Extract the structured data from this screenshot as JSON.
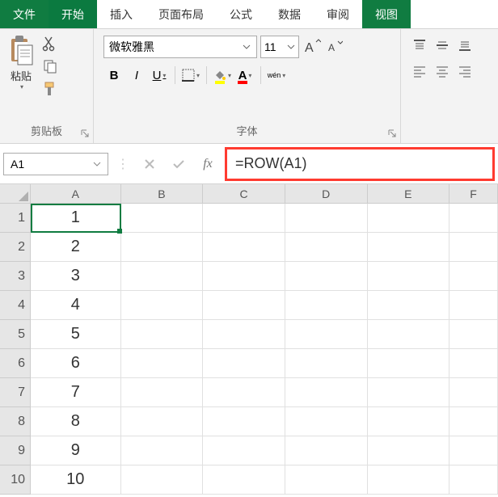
{
  "menu": {
    "file": "文件",
    "home": "开始",
    "insert": "插入",
    "layout": "页面布局",
    "formula": "公式",
    "data": "数据",
    "review": "审阅",
    "view": "视图"
  },
  "ribbon": {
    "clipboard": {
      "label": "剪贴板",
      "paste": "粘贴"
    },
    "font": {
      "label": "字体",
      "name": "微软雅黑",
      "size": "11",
      "wen": "wén"
    }
  },
  "formula_bar": {
    "cell_ref": "A1",
    "formula": "=ROW(A1)"
  },
  "grid": {
    "columns": [
      "A",
      "B",
      "C",
      "D",
      "E",
      "F"
    ],
    "rows": [
      "1",
      "2",
      "3",
      "4",
      "5",
      "6",
      "7",
      "8",
      "9",
      "10"
    ],
    "valuesA": [
      "1",
      "2",
      "3",
      "4",
      "5",
      "6",
      "7",
      "8",
      "9",
      "10"
    ]
  },
  "chart_data": {
    "type": "table",
    "title": "",
    "columns": [
      "A"
    ],
    "data": [
      [
        1
      ],
      [
        2
      ],
      [
        3
      ],
      [
        4
      ],
      [
        5
      ],
      [
        6
      ],
      [
        7
      ],
      [
        8
      ],
      [
        9
      ],
      [
        10
      ]
    ],
    "formula_A": "=ROW(A1)"
  }
}
